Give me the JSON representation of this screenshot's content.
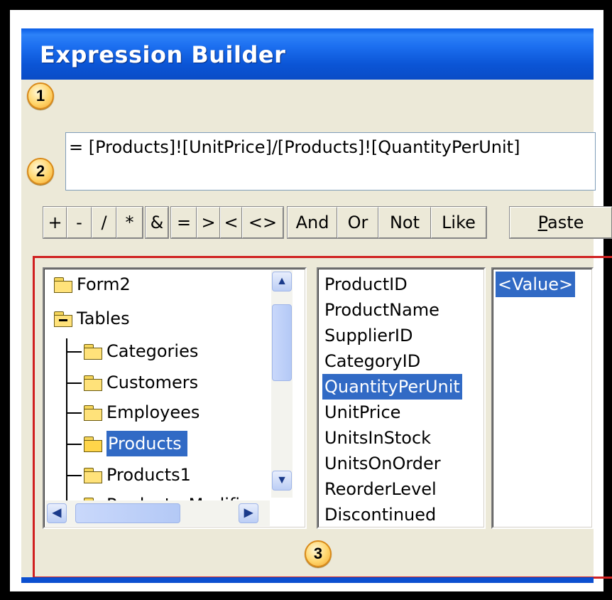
{
  "dialog": {
    "title": "Expression Builder",
    "expression": "= [Products]![UnitPrice]/[Products]![QuantityPerUnit]"
  },
  "callouts": [
    "1",
    "2",
    "3"
  ],
  "operators": {
    "arith": [
      "+",
      "-",
      "/",
      "*"
    ],
    "concat": [
      "&"
    ],
    "compare": [
      "=",
      ">",
      "<",
      "<>"
    ],
    "logic": [
      "And",
      "Or",
      "Not",
      "Like"
    ],
    "paste_label": "Paste",
    "paste_accel": "P",
    "paste_rest": "aste"
  },
  "tree": {
    "items": [
      {
        "label": "Form2",
        "icon": "folder-icon"
      },
      {
        "label": "Tables",
        "icon": "folder-minus-icon"
      },
      {
        "label": "Categories",
        "icon": "folder-icon"
      },
      {
        "label": "Customers",
        "icon": "folder-icon"
      },
      {
        "label": "Employees",
        "icon": "folder-icon"
      },
      {
        "label": "Products",
        "icon": "folder-open-icon",
        "selected": true
      },
      {
        "label": "Products1",
        "icon": "folder-icon"
      },
      {
        "label": "Products_Modifi",
        "icon": "folder-icon"
      }
    ]
  },
  "fields": {
    "items": [
      "ProductID",
      "ProductName",
      "SupplierID",
      "CategoryID",
      "QuantityPerUnit",
      "UnitPrice",
      "UnitsInStock",
      "UnitsOnOrder",
      "ReorderLevel",
      "Discontinued"
    ],
    "selected": "QuantityPerUnit"
  },
  "values": {
    "items": [
      "<Value>"
    ]
  },
  "colors": {
    "title_bar": "#0b55d6",
    "selection": "#316ac5",
    "callout_outline": "#d02020"
  }
}
